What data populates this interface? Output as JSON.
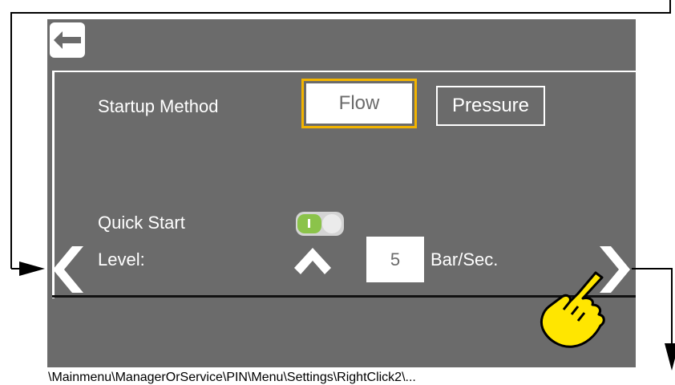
{
  "settings": {
    "startup_label": "Startup Method",
    "options": [
      "Flow",
      "Pressure"
    ],
    "selected": "Flow",
    "quick_start_label": "Quick Start",
    "quick_start_on": true,
    "level_label": "Level:",
    "level_value": "5",
    "level_unit": "Bar/Sec."
  },
  "breadcrumb": "\\Mainmenu\\ManagerOrService\\PIN\\Menu\\Settings\\RightClick2\\...",
  "colors": {
    "screen_bg": "#6b6b6b",
    "selected_border": "#f2b400",
    "toggle_on": "#8bc34a",
    "hand": "#ffe600"
  },
  "icons": [
    "back-arrow-icon",
    "chevron-left-icon",
    "chevron-right-icon",
    "chevron-up-icon",
    "pointing-hand-icon"
  ]
}
